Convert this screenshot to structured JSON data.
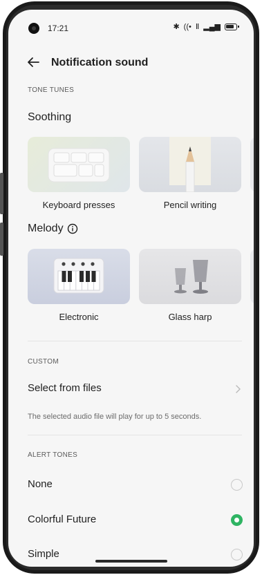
{
  "status_bar": {
    "time": "17:21",
    "bluetooth_glyph": "✱",
    "wifi_glyph": "((•",
    "data_label": "Ⅱ",
    "signal_glyph": "▂▄▆"
  },
  "header": {
    "back_icon": "arrow-left-icon",
    "title": "Notification sound"
  },
  "tone_tunes": {
    "section_label": "TONE TUNES",
    "soothing": {
      "title": "Soothing",
      "items": [
        {
          "label": "Keyboard presses",
          "icon": "keyboard-keys-image"
        },
        {
          "label": "Pencil writing",
          "icon": "pencil-image"
        }
      ]
    },
    "melody": {
      "title": "Melody",
      "info_icon": "info-circle-icon",
      "items": [
        {
          "label": "Electronic",
          "icon": "piano-keyboard-image"
        },
        {
          "label": "Glass harp",
          "icon": "glasses-image"
        }
      ]
    }
  },
  "custom": {
    "section_label": "CUSTOM",
    "select_files_label": "Select from files",
    "helper_text": "The selected audio file will play for up to 5 seconds."
  },
  "alert_tones": {
    "section_label": "ALERT TONES",
    "options": [
      {
        "label": "None",
        "selected": false
      },
      {
        "label": "Colorful Future",
        "selected": true
      },
      {
        "label": "Simple",
        "selected": false
      }
    ]
  },
  "colors": {
    "accent": "#2fb463",
    "background": "#f6f6f6"
  }
}
